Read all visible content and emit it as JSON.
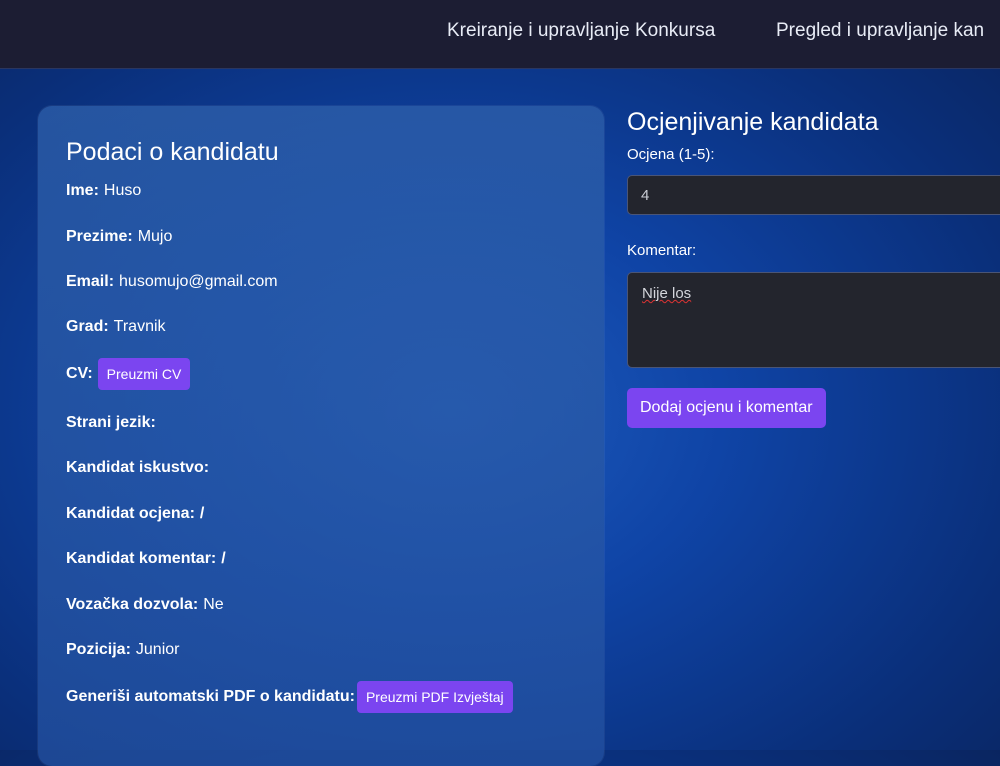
{
  "nav": {
    "links": [
      "Kreiranje i upravljanje Konkursa",
      "Pregled i upravljanje kan"
    ]
  },
  "candidate": {
    "title": "Podaci o kandidatu",
    "fields": [
      {
        "label": "Ime:",
        "value": "Huso"
      },
      {
        "label": "Prezime:",
        "value": "Mujo"
      },
      {
        "label": "Email:",
        "value": "husomujo@gmail.com"
      },
      {
        "label": "Grad:",
        "value": "Travnik"
      },
      {
        "label": "CV:",
        "value": ""
      },
      {
        "label": "Strani jezik:",
        "value": ""
      },
      {
        "label": "Kandidat iskustvo:",
        "value": ""
      },
      {
        "label": "Kandidat ocjena:",
        "value": "/"
      },
      {
        "label": "Kandidat komentar:",
        "value": "/"
      },
      {
        "label": "Vozačka dozvola:",
        "value": "Ne"
      },
      {
        "label": "Pozicija:",
        "value": "Junior"
      },
      {
        "label": "Generiši automatski PDF o kandidatu:",
        "value": ""
      }
    ],
    "cv_button": "Preuzmi CV",
    "pdf_button": "Preuzmi PDF Izvještaj"
  },
  "rating": {
    "title": "Ocjenjivanje kandidata",
    "grade_label": "Ocjena (1-5):",
    "grade_value": "4",
    "comment_label": "Komentar:",
    "comment_value": "Nije los",
    "submit_label": "Dodaj ocjenu i komentar"
  },
  "colors": {
    "accent": "#7b45f0",
    "topbar": "#1c1d33"
  }
}
